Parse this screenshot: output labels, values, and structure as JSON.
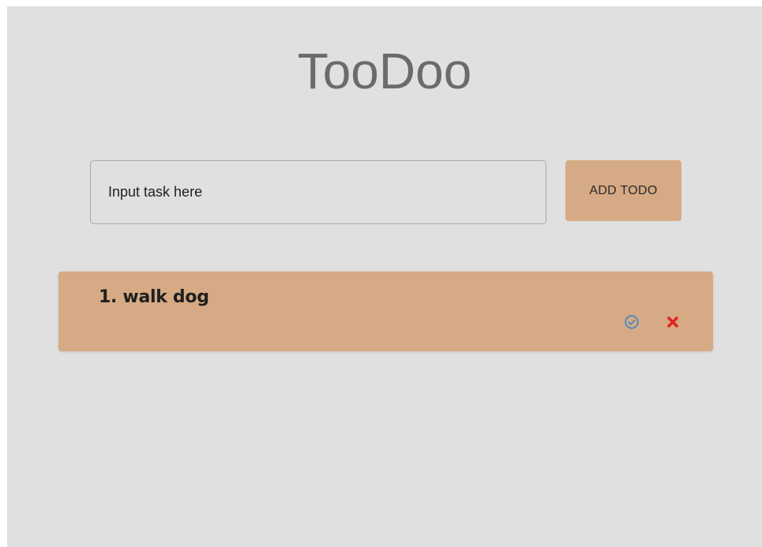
{
  "app": {
    "title": "TooDoo"
  },
  "form": {
    "input_value": "",
    "input_placeholder": "Input task here",
    "add_label": "ADD TODO"
  },
  "todos": [
    {
      "number": "1.",
      "text": "walk dog",
      "label": "1. walk dog",
      "complete_icon": "check-circle-icon",
      "delete_icon": "close-icon"
    }
  ],
  "colors": {
    "background": "#e0e0e0",
    "accent": "#d6aa84",
    "title_text": "#6b6b6b",
    "complete_icon": "#4a86c8",
    "delete_icon": "#e02424"
  }
}
